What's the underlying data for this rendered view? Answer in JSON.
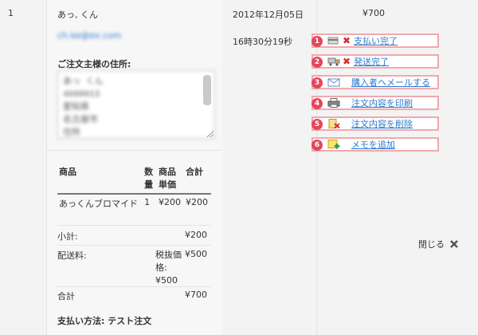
{
  "row_number": "1",
  "customer": {
    "name": "あっ, くん",
    "email": "ch.ke@ex.com"
  },
  "address": {
    "label": "ご注文主様の住所:",
    "lines": [
      "あっ くん",
      "4600013",
      "愛知県",
      "名古屋市",
      "住所"
    ]
  },
  "order": {
    "date": "2012年12月05日",
    "time": "16時30分19秒",
    "total": "¥700"
  },
  "items": {
    "headers": {
      "product": "商品",
      "qty": "数量",
      "unit_price": "商品単価",
      "subtotal": "合計"
    },
    "rows": [
      {
        "product": "あっくんブロマイド",
        "qty": "1",
        "unit_price": "¥200",
        "subtotal": "¥200"
      }
    ],
    "subtotal_label": "小計:",
    "subtotal_value": "¥200",
    "shipping_label": "配送料:",
    "shipping_note": "税抜価格: ¥500",
    "shipping_value": "¥500",
    "total_label": "合計",
    "total_value": "¥700"
  },
  "payment": {
    "label": "支払い方法:",
    "value": "テスト注文"
  },
  "actions": [
    {
      "num": "1",
      "label": "支払い完了",
      "icon": "payment-icon",
      "has_x": true
    },
    {
      "num": "2",
      "label": "発送完了",
      "icon": "truck-icon",
      "has_x": true
    },
    {
      "num": "3",
      "label": "購入者へメールする",
      "icon": "mail-icon",
      "has_x": false
    },
    {
      "num": "4",
      "label": "注文内容を印刷",
      "icon": "print-icon",
      "has_x": false
    },
    {
      "num": "5",
      "label": "注文内容を削除",
      "icon": "delete-icon",
      "has_x": false
    },
    {
      "num": "6",
      "label": "メモを追加",
      "icon": "memo-add-icon",
      "has_x": false
    }
  ],
  "close": {
    "label": "閉じる"
  },
  "colors": {
    "link": "#2a7ad0",
    "highlight_border": "#f1a8ad",
    "badge": "#e3475c"
  }
}
